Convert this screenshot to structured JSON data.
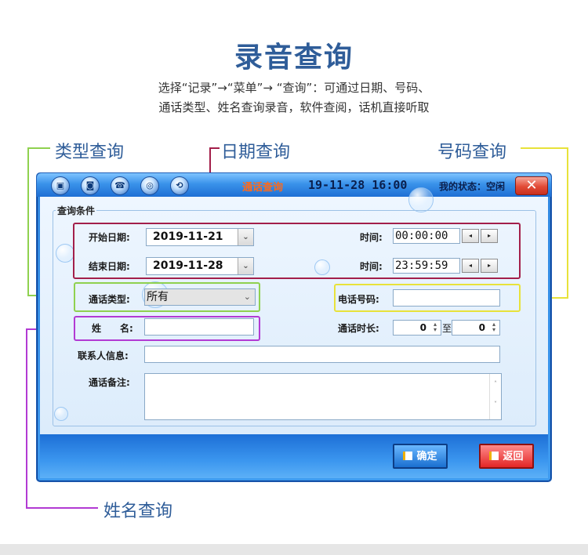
{
  "page": {
    "title": "录音查询",
    "desc_line1": "选择“记录”→“菜单”→ “查询”：可通过日期、号码、",
    "desc_line2": "通话类型、姓名查询录音，软件查阅，话机直接听取"
  },
  "callouts": {
    "type_query": "类型查询",
    "date_query": "日期查询",
    "number_query": "号码查询",
    "name_query": "姓名查询"
  },
  "colors": {
    "date_highlight": "#a31f4a",
    "type_highlight": "#8fd14f",
    "number_highlight": "#e8e23a",
    "name_highlight": "#b23ad3",
    "title_blue": "#2f5d99"
  },
  "window": {
    "title": "通话查询",
    "datetime": "19-11-28 16:00",
    "status": "我的状态：空闲",
    "toolbar_icons": [
      "tool-icon-1",
      "tool-icon-2",
      "tool-icon-3",
      "tool-icon-4",
      "tool-icon-5"
    ]
  },
  "form": {
    "group_label": "查询条件",
    "start_date_label": "开始日期:",
    "start_date": "2019-11-21",
    "end_date_label": "结束日期:",
    "end_date": "2019-11-28",
    "start_time_label": "时间:",
    "start_time": "00:00:00",
    "end_time_label": "时间:",
    "end_time": "23:59:59",
    "call_type_label": "通话类型:",
    "call_type_value": "所有",
    "phone_label": "电话号码:",
    "phone_value": "",
    "name_label": "姓　　名:",
    "name_value": "",
    "duration_label": "通话时长:",
    "duration_from": "0",
    "duration_to_label": "至",
    "duration_to": "0",
    "contact_label": "联系人信息:",
    "contact_value": "",
    "note_label": "通话备注:",
    "note_value": ""
  },
  "buttons": {
    "ok": "确定",
    "back": "返回"
  }
}
